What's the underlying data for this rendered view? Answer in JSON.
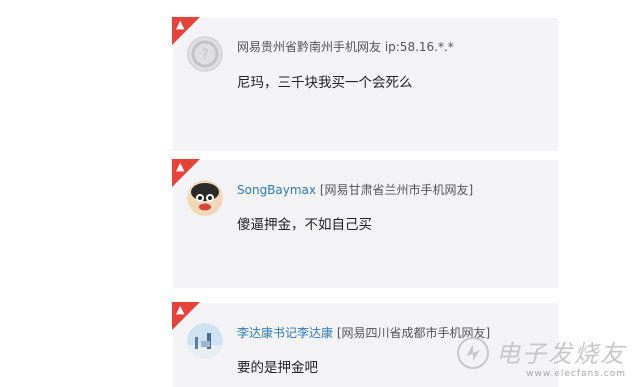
{
  "comments": [
    {
      "user": "",
      "location": "网易贵州省黔南州手机网友 ip:58.16.*.*",
      "text": "尼玛，三千块我买一个会死么"
    },
    {
      "user": "SongBaymax",
      "location": "[网易甘肃省兰州市手机网友]",
      "text": "傻逼押金，不如自己买"
    },
    {
      "user": "李达康书记李达康",
      "location": "[网易四川省成都市手机网友]",
      "text": "要的是押金吧"
    }
  ],
  "watermark": {
    "title": "电子发烧友",
    "url": "www.elecfans.com"
  },
  "colors": {
    "hot_badge": "#e8413a",
    "username": "#2b7bbd",
    "card_bg": "#f4f4f6"
  }
}
